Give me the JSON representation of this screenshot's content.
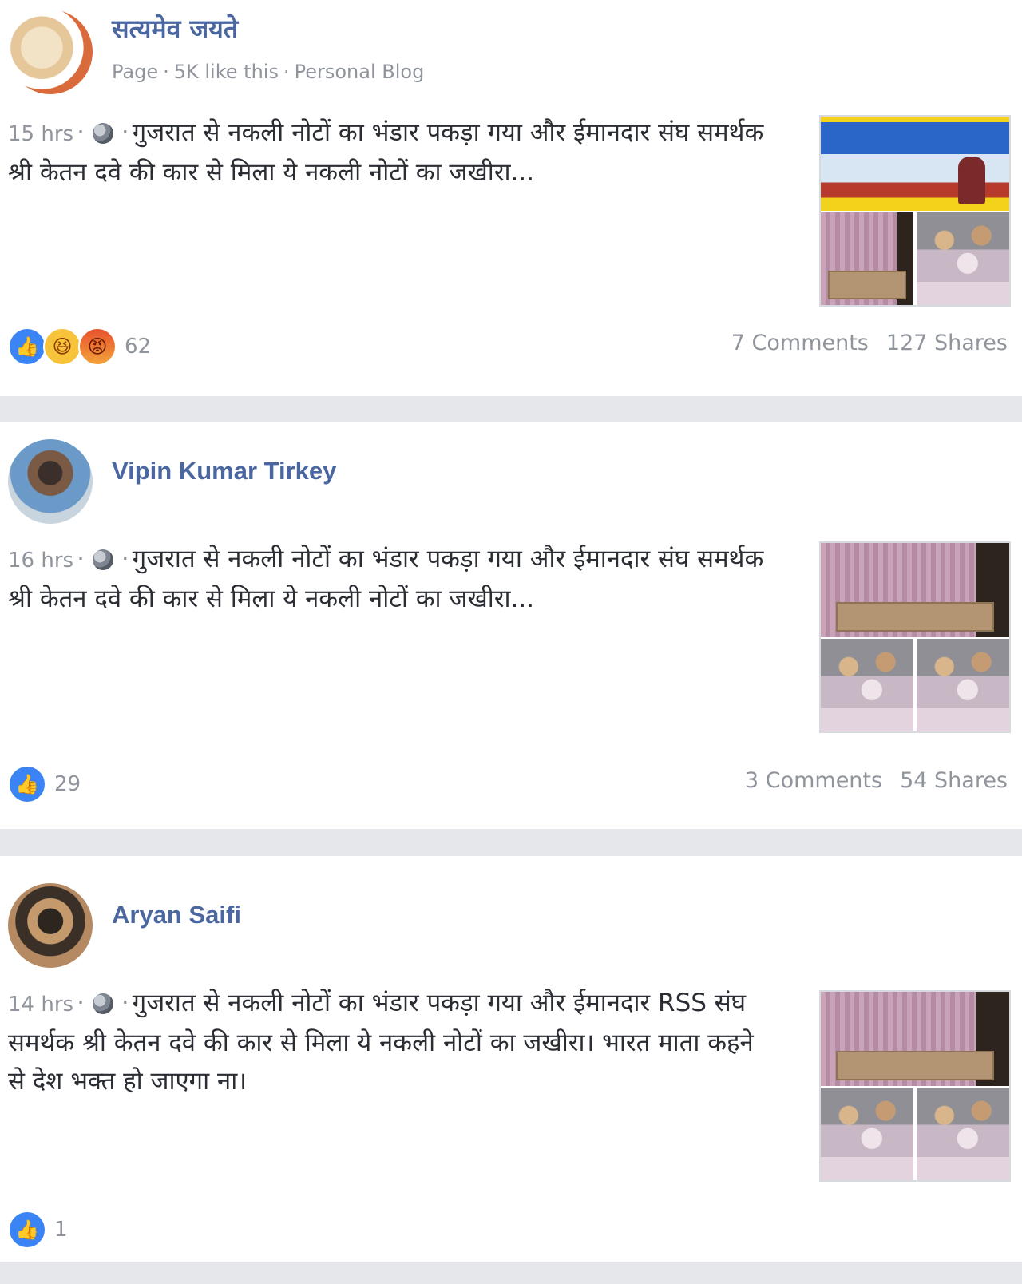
{
  "posts": [
    {
      "author": "सत्यमेव जयते",
      "meta": {
        "type": "Page",
        "likes": "5K like this",
        "category": "Personal Blog"
      },
      "time": "15 hrs",
      "text": "गुजरात से नकली नोटों का भंडार पकड़ा गया और ईमानदार संघ समर्थक श्री केतन दवे की कार से मिला ये नकली नोटों का जखीरा...",
      "reaction_count": "62",
      "comments": "7 Comments",
      "shares": "127 Shares"
    },
    {
      "author": "Vipin Kumar Tirkey",
      "time": "16 hrs",
      "text": "गुजरात से नकली नोटों का भंडार पकड़ा गया और ईमानदार संघ समर्थक श्री केतन दवे की कार से मिला ये नकली नोटों का जखीरा...",
      "reaction_count": "29",
      "comments": "3 Comments",
      "shares": "54 Shares"
    },
    {
      "author": "Aryan Saifi",
      "time": "14 hrs",
      "text": "गुजरात से नकली नोटों का भंडार पकड़ा गया और ईमानदार RSS संघ समर्थक श्री केतन दवे की कार से मिला ये नकली नोटों का जखीरा। भारत माता कहने से देश भक्त हो जाएगा ना।",
      "reaction_count": "1"
    }
  ],
  "icons": {
    "reaction_like": "like-icon",
    "reaction_haha": "haha-icon",
    "reaction_angry": "angry-icon",
    "privacy": "globe-icon"
  },
  "colors": {
    "author_name": "#4b67a1",
    "meta_text": "#90949c",
    "like_blue": "#3b84f6",
    "separator": "#e5e7ea"
  }
}
